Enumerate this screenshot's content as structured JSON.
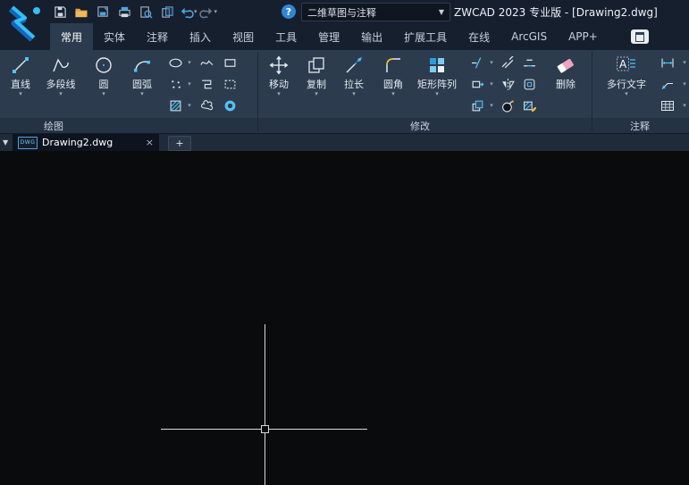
{
  "titlebar": {
    "title": "ZWCAD 2023 专业版 - [Drawing2.dwg]",
    "workspace": "二维草图与注释",
    "help": "?"
  },
  "icons": {
    "caret": "▾",
    "caret_down": "▼",
    "plus": "+"
  },
  "ribbon_tabs": [
    "常用",
    "实体",
    "注释",
    "插入",
    "视图",
    "工具",
    "管理",
    "输出",
    "扩展工具",
    "在线",
    "ArcGIS",
    "APP+"
  ],
  "panels": {
    "draw": {
      "label": "绘图",
      "buttons": [
        "直线",
        "多段线",
        "圆",
        "圆弧"
      ]
    },
    "modify": {
      "label": "修改",
      "buttons": [
        "移动",
        "复制",
        "拉长",
        "圆角",
        "矩形阵列",
        "删除"
      ]
    },
    "annotate": {
      "label": "注释",
      "buttons": [
        "多行文字"
      ]
    }
  },
  "doc_bar": {
    "active_tab": "Drawing2.dwg",
    "badge": "DWG",
    "close": "×"
  },
  "colors": {
    "accent": "#4fc3f7",
    "titlebar_bg": "#161f2e",
    "ribbon_bg": "#2c3b4d",
    "canvas_bg": "#0a0b0d"
  }
}
